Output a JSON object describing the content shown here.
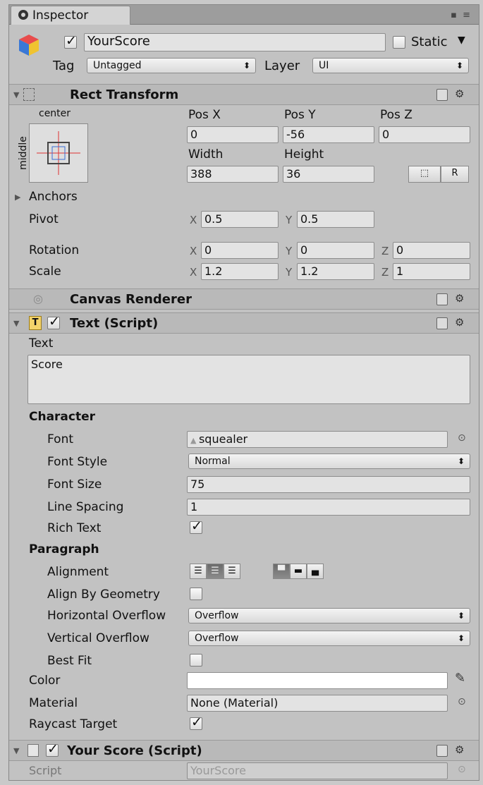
{
  "window": {
    "tab_title": "Inspector"
  },
  "object": {
    "active": true,
    "name": "YourScore",
    "static_label": "Static",
    "static": false,
    "tag_label": "Tag",
    "tag_value": "Untagged",
    "layer_label": "Layer",
    "layer_value": "UI"
  },
  "rect_transform": {
    "title": "Rect Transform",
    "anchor_h": "center",
    "anchor_v": "middle",
    "pos_x_label": "Pos X",
    "pos_x": "0",
    "pos_y_label": "Pos Y",
    "pos_y": "-56",
    "pos_z_label": "Pos Z",
    "pos_z": "0",
    "width_label": "Width",
    "width": "388",
    "height_label": "Height",
    "height": "36",
    "raw_edit_label": "R",
    "anchors_label": "Anchors",
    "pivot_label": "Pivot",
    "pivot_x": "0.5",
    "pivot_y": "0.5",
    "rotation_label": "Rotation",
    "rot_x": "0",
    "rot_y": "0",
    "rot_z": "0",
    "scale_label": "Scale",
    "scale_x": "1.2",
    "scale_y": "1.2",
    "scale_z": "1",
    "axis_x": "X",
    "axis_y": "Y",
    "axis_z": "Z"
  },
  "canvas_renderer": {
    "title": "Canvas Renderer"
  },
  "text_script": {
    "title": "Text (Script)",
    "enabled": true,
    "text_label": "Text",
    "text_value": "Score",
    "character_label": "Character",
    "font_label": "Font",
    "font_value": "squealer",
    "font_style_label": "Font Style",
    "font_style_value": "Normal",
    "font_size_label": "Font Size",
    "font_size_value": "75",
    "line_spacing_label": "Line Spacing",
    "line_spacing_value": "1",
    "rich_text_label": "Rich Text",
    "rich_text": true,
    "paragraph_label": "Paragraph",
    "alignment_label": "Alignment",
    "align_by_geometry_label": "Align By Geometry",
    "align_by_geometry": false,
    "horizontal_overflow_label": "Horizontal Overflow",
    "horizontal_overflow_value": "Overflow",
    "vertical_overflow_label": "Vertical Overflow",
    "vertical_overflow_value": "Overflow",
    "best_fit_label": "Best Fit",
    "best_fit": false,
    "color_label": "Color",
    "color_value": "#ffffff",
    "material_label": "Material",
    "material_value": "None (Material)",
    "raycast_target_label": "Raycast Target",
    "raycast_target": true
  },
  "your_score_script": {
    "title": "Your Score (Script)",
    "enabled": true,
    "script_label": "Script",
    "script_value": "YourScore"
  },
  "icons": {
    "inspector": "info-icon",
    "gameobject": "cube-icon",
    "settings": "gear-icon",
    "help": "book-icon",
    "picker": "object-picker-icon",
    "eyedropper": "eyedropper-icon"
  }
}
